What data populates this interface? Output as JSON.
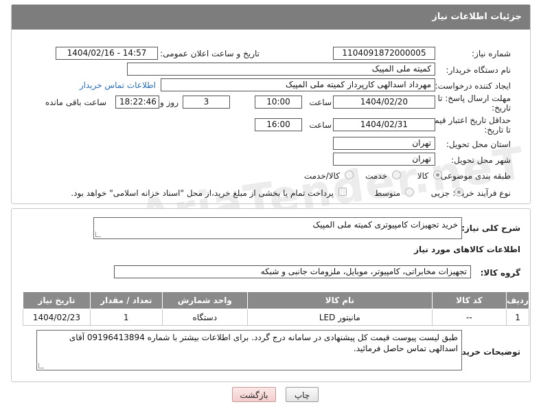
{
  "header": {
    "title": "جزئیات اطلاعات نیاز"
  },
  "fields": {
    "need_number": {
      "label": "شماره نیاز:",
      "value": "1104091872000005"
    },
    "announce_datetime": {
      "label": "تاریخ و ساعت اعلان عمومی:",
      "value": "1404/02/16 - 14:57"
    },
    "buyer_org": {
      "label": "نام دستگاه خریدار:",
      "value": "کمیته ملی المپیک"
    },
    "requester": {
      "label": "ایجاد کننده درخواست:",
      "value": "مهرداد اسدالهی کارپرداز کمیته ملی المپیک",
      "contact_link": "اطلاعات تماس خریدار"
    },
    "reply_deadline": {
      "label_line1": "مهلت ارسال پاسخ: تا",
      "label_line2": "تاریخ:",
      "date": "1404/02/20",
      "time_label": "ساعت",
      "time": "10:00",
      "days": "3",
      "days_label": "روز و",
      "remaining": "18:22:46",
      "remaining_label": "ساعت باقی مانده"
    },
    "price_validity": {
      "label_line1": "حداقل تاریخ اعتبار قیمت:",
      "label_line2": "تا تاریخ:",
      "date": "1404/02/31",
      "time_label": "ساعت",
      "time": "16:00"
    },
    "delivery_province": {
      "label": "استان محل تحویل:",
      "value": "تهران"
    },
    "delivery_city": {
      "label": "شهر محل تحویل:",
      "value": "تهران"
    },
    "category": {
      "label": "طبقه بندی موضوعی:",
      "options": [
        "کالا",
        "خدمت",
        "کالا/خدمت"
      ],
      "selected": "کالا"
    },
    "process_type": {
      "label": "نوع فرآیند خرید :",
      "options": [
        "جزیی",
        "متوسط"
      ],
      "selected": "جزیی",
      "payment_note": "پرداخت تمام یا بخشی از مبلغ خرید،از محل \"اسناد خزانه اسلامی\" خواهد بود."
    }
  },
  "description": {
    "label": "شرح کلی نیاز:",
    "value": "خرید تجهیزات کامپیوتری کمیته ملی المپیک"
  },
  "goods_section": {
    "title": "اطلاعات کالاهای مورد نیاز",
    "group_label": "گروه کالا:",
    "group_value": "تجهیزات مخابراتی، کامپیوتر، موبایل، ملزومات جانبی و شبکه"
  },
  "items_table": {
    "headers": [
      "ردیف",
      "کد کالا",
      "نام کالا",
      "واحد شمارش",
      "تعداد / مقدار",
      "تاریخ نیاز"
    ],
    "rows": [
      [
        "1",
        "--",
        "مانیتور LED",
        "دستگاه",
        "1",
        "1404/02/23"
      ]
    ]
  },
  "buyer_notes": {
    "label": "توضیحات خریدار:",
    "value": "طبق لیست پیوست قیمت کل پیشنهادی در سامانه درج گردد. برای اطلاعات بیشتر با شماره 09196413894 آقای اسدالهی تماس حاصل فرمائید."
  },
  "buttons": {
    "print": "چاپ",
    "back": "بازگشت"
  },
  "watermark": {
    "text": "AriaTender.neT"
  },
  "colors": {
    "header_bg": "#7d7d7d",
    "link": "#2a6fb8",
    "back_button": "#f3cccc"
  }
}
